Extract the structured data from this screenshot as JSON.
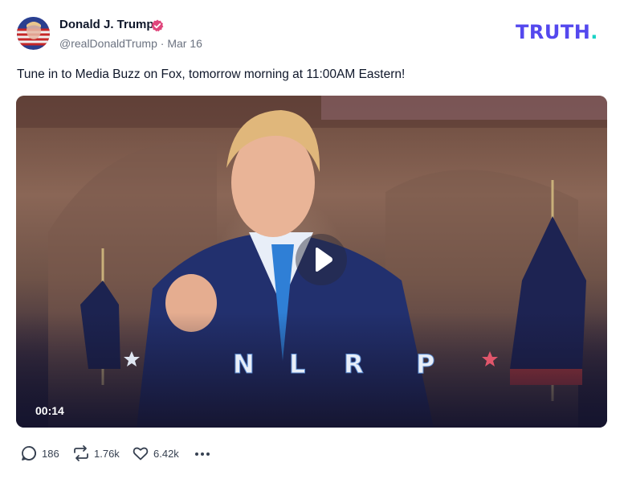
{
  "post": {
    "author_name": "Donald J. Trump",
    "handle": "@realDonaldTrump",
    "separator": "·",
    "date": "Mar 16",
    "text": "Tune in to Media Buzz on Fox, tomorrow morning at 11:00AM Eastern!"
  },
  "brand": {
    "logo_text": "TRUTH",
    "logo_dot": "."
  },
  "video": {
    "duration": "00:14",
    "overlay_letters": [
      "N",
      "L",
      "R",
      "P"
    ]
  },
  "actions": {
    "replies": "186",
    "retruths": "1.76k",
    "likes": "6.42k"
  },
  "colors": {
    "verified": "#e0457b",
    "brand": "#5448ee",
    "brand_dot": "#19d3c5"
  },
  "icons": [
    "verified-icon",
    "play-icon",
    "reply-icon",
    "retruth-icon",
    "like-icon",
    "more-icon"
  ]
}
